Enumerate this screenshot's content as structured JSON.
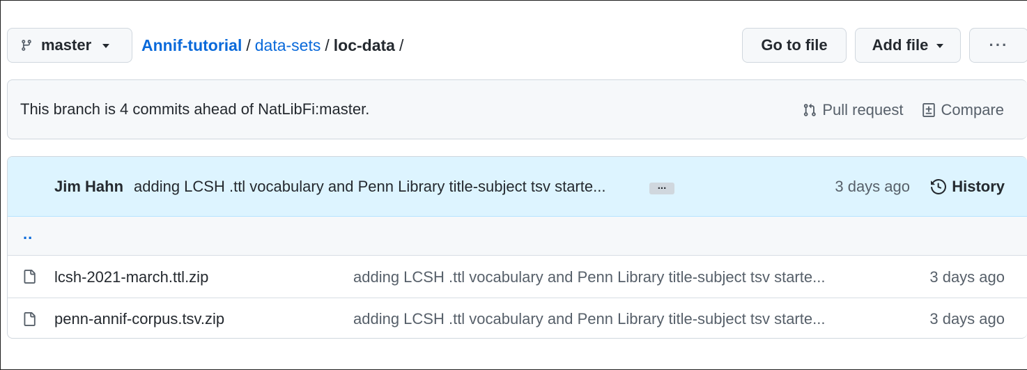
{
  "toolbar": {
    "branch_label": "master",
    "goto_label": "Go to file",
    "addfile_label": "Add file",
    "more_label": "···"
  },
  "breadcrumb": {
    "repo": "Annif-tutorial",
    "sep1": "/",
    "folder": "data-sets",
    "sep2": "/",
    "current": "loc-data",
    "sep3": "/"
  },
  "branch_status": {
    "text": "This branch is 4 commits ahead of NatLibFi:master.",
    "pull_request_label": "Pull request",
    "compare_label": "Compare"
  },
  "latest_commit": {
    "author": "Jim Hahn",
    "message": "adding LCSH .ttl vocabulary and Penn Library title-subject tsv starte...",
    "expand_label": "...",
    "time": "3 days ago",
    "history_label": "History"
  },
  "parent_dir": "..",
  "files": [
    {
      "icon": "file-icon",
      "name": "lcsh-2021-march.ttl.zip",
      "commit": "adding LCSH .ttl vocabulary and Penn Library title-subject tsv starte...",
      "time": "3 days ago"
    },
    {
      "icon": "file-icon",
      "name": "penn-annif-corpus.tsv.zip",
      "commit": "adding LCSH .ttl vocabulary and Penn Library title-subject tsv starte...",
      "time": "3 days ago"
    }
  ],
  "colors": {
    "link": "#0969da",
    "commit_bg": "#ddf4ff",
    "muted": "#57606a",
    "border": "#d0d7de"
  }
}
